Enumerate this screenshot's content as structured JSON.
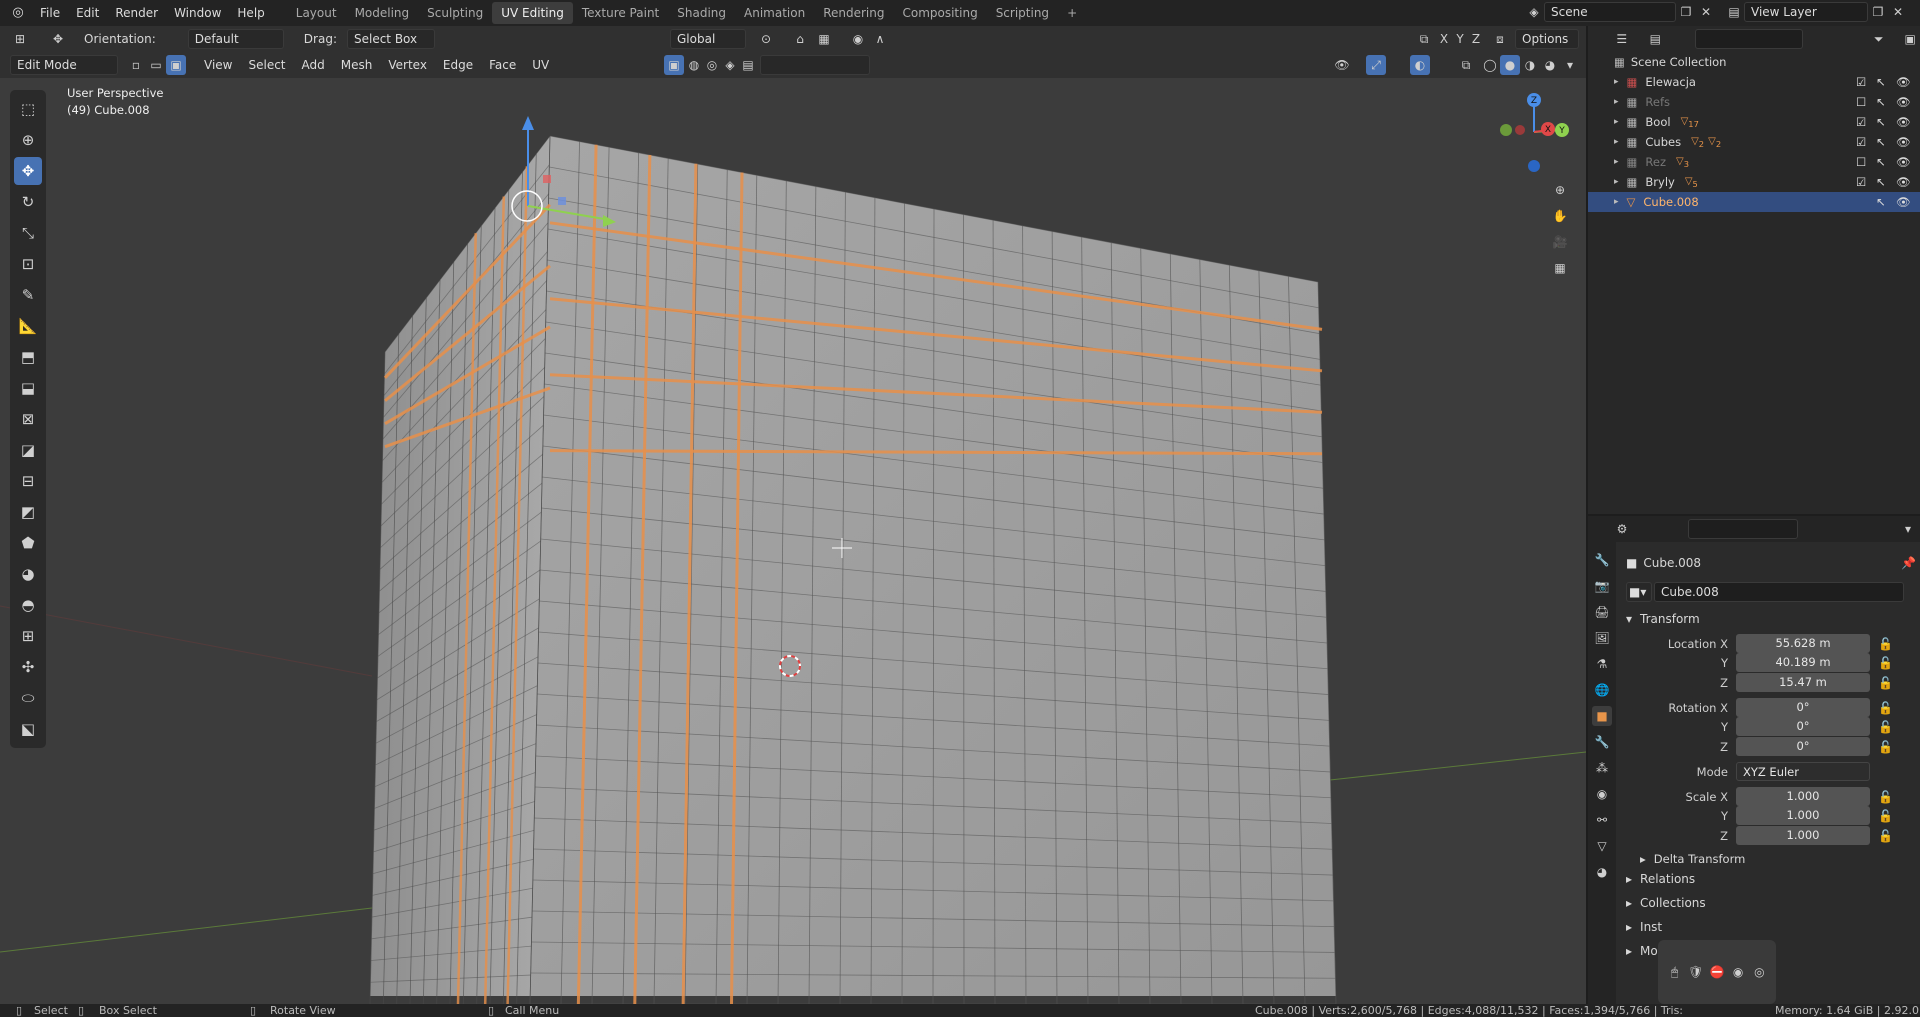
{
  "menus": [
    "File",
    "Edit",
    "Render",
    "Window",
    "Help"
  ],
  "workspaces": [
    "Layout",
    "Modeling",
    "Sculpting",
    "UV Editing",
    "Texture Paint",
    "Shading",
    "Animation",
    "Rendering",
    "Compositing",
    "Scripting"
  ],
  "active_workspace": "UV Editing",
  "scene": {
    "label": "Scene",
    "view_layer": "View Layer"
  },
  "tool_header": {
    "orientation_label": "Orientation:",
    "orientation_value": "Default",
    "drag_label": "Drag:",
    "drag_value": "Select Box",
    "transform_orientation": "Global",
    "options": "Options"
  },
  "header2": {
    "mode": "Edit Mode",
    "menus": [
      "View",
      "Select",
      "Add",
      "Mesh",
      "Vertex",
      "Edge",
      "Face",
      "UV"
    ]
  },
  "viewport": {
    "view_name": "User Perspective",
    "object_info": "(49) Cube.008"
  },
  "outliner": {
    "root": "Scene Collection",
    "rows": [
      {
        "name": "Elewacja"
      },
      {
        "name": "Refs"
      },
      {
        "name": "Bool",
        "badge": "17"
      },
      {
        "name": "Cubes",
        "badge": "2",
        "badge2": "2"
      },
      {
        "name": "Rez",
        "badge": "3"
      },
      {
        "name": "Bryly",
        "badge": "5"
      },
      {
        "name": "Cube.008"
      }
    ]
  },
  "properties": {
    "object_name": "Cube.008",
    "datablock": "Cube.008",
    "transform_header": "Transform",
    "location": {
      "label": "Location X",
      "x": "55.628 m",
      "y": "40.189 m",
      "z": "15.47 m"
    },
    "rotation": {
      "label": "Rotation X",
      "x": "0°",
      "y": "0°",
      "z": "0°"
    },
    "mode_label": "Mode",
    "mode_value": "XYZ Euler",
    "scale": {
      "label": "Scale X",
      "x": "1.000",
      "y": "1.000",
      "z": "1.000"
    },
    "axis_y": "Y",
    "axis_z": "Z",
    "delta": "Delta Transform",
    "sections": [
      "Relations",
      "Collections",
      "Inst",
      "Mot"
    ]
  },
  "status": {
    "select": "Select",
    "box_select": "Box Select",
    "rotate_view": "Rotate View",
    "call_menu": "Call Menu",
    "stats": "Cube.008 | Verts:2,600/5,768 | Edges:4,088/11,532 | Faces:1,394/5,766 | Tris:",
    "memory": "Memory: 1.64 GiB | 2.92.0"
  },
  "colors": {
    "accent": "#4772b3",
    "selected_edge": "#e8904a",
    "object_orange": "#e8954a"
  }
}
